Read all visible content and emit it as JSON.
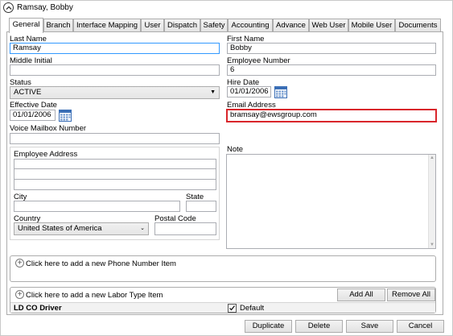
{
  "window": {
    "title": "Ramsay, Bobby"
  },
  "tabs": [
    {
      "label": "General"
    },
    {
      "label": "Branch"
    },
    {
      "label": "Interface Mapping"
    },
    {
      "label": "User"
    },
    {
      "label": "Dispatch"
    },
    {
      "label": "Safety"
    },
    {
      "label": "Accounting"
    },
    {
      "label": "Advance"
    },
    {
      "label": "Web User"
    },
    {
      "label": "Mobile User"
    },
    {
      "label": "Documents"
    }
  ],
  "form": {
    "last_name_label": "Last Name",
    "last_name_value": "Ramsay",
    "first_name_label": "First Name",
    "first_name_value": "Bobby",
    "middle_initial_label": "Middle Initial",
    "middle_initial_value": "",
    "employee_number_label": "Employee Number",
    "employee_number_value": "6",
    "status_label": "Status",
    "status_value": "ACTIVE",
    "hire_date_label": "Hire Date",
    "hire_date_value": "01/01/2006",
    "effective_date_label": "Effective Date",
    "effective_date_value": "01/01/2006",
    "email_label": "Email Address",
    "email_value": "bramsay@ewsgroup.com",
    "voice_mailbox_label": "Voice Mailbox Number",
    "voice_mailbox_value": "",
    "note_label": "Note",
    "address": {
      "label": "Employee Address",
      "line1": "",
      "line2": "",
      "line3": "",
      "city_label": "City",
      "city_value": "",
      "state_label": "State",
      "state_value": "",
      "country_label": "Country",
      "country_value": "United States of America",
      "postal_label": "Postal Code",
      "postal_value": ""
    }
  },
  "phone": {
    "add_label": "Click here to add a new Phone Number Item"
  },
  "labor": {
    "add_label": "Click here to add a new Labor Type Item",
    "add_all": "Add All",
    "remove_all": "Remove All",
    "row_name": "LD CO Driver",
    "default_label": "Default",
    "default_checked": true
  },
  "footer": {
    "duplicate": "Duplicate",
    "delete": "Delete",
    "save": "Save",
    "cancel": "Cancel"
  },
  "colors": {
    "error_border": "#d9262b",
    "focus_border": "#3399ff"
  }
}
